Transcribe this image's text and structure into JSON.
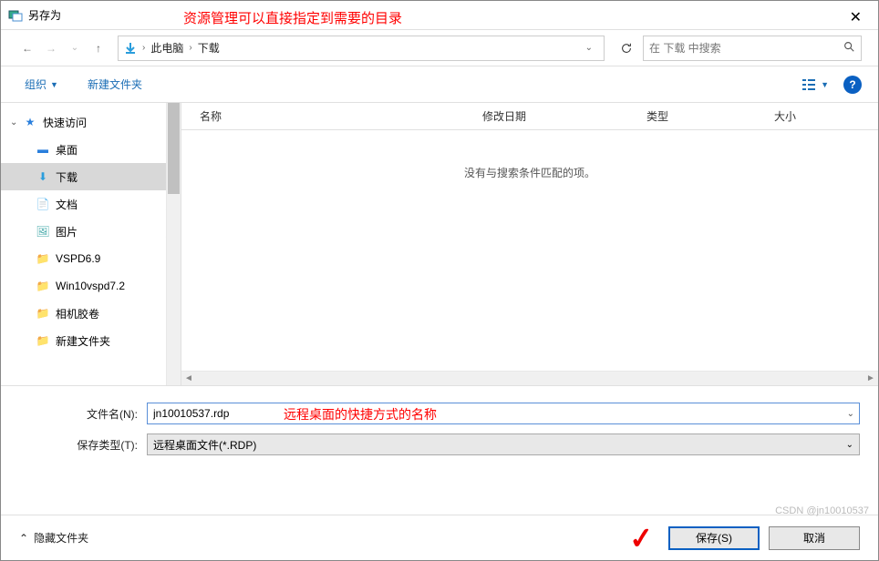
{
  "title": "另存为",
  "annotation_top": "资源管理可以直接指定到需要的目录",
  "breadcrumb": {
    "seg1": "此电脑",
    "seg2": "下载"
  },
  "search": {
    "placeholder": "在 下载 中搜索"
  },
  "toolbar": {
    "organize": "组织",
    "new_folder": "新建文件夹"
  },
  "tree": {
    "quick_access": "快速访问",
    "items": [
      {
        "label": "桌面",
        "pinned": true
      },
      {
        "label": "下载",
        "pinned": true
      },
      {
        "label": "文档",
        "pinned": true
      },
      {
        "label": "图片",
        "pinned": true
      },
      {
        "label": "VSPD6.9",
        "pinned": false
      },
      {
        "label": "Win10vspd7.2",
        "pinned": false
      },
      {
        "label": "相机胶卷",
        "pinned": false
      },
      {
        "label": "新建文件夹",
        "pinned": false
      }
    ]
  },
  "columns": {
    "name": "名称",
    "date": "修改日期",
    "type": "类型",
    "size": "大小"
  },
  "empty_message": "没有与搜索条件匹配的项。",
  "form": {
    "filename_label": "文件名(N):",
    "filename_value": "jn10010537.rdp",
    "filetype_label": "保存类型(T):",
    "filetype_value": "远程桌面文件(*.RDP)"
  },
  "annotation_filename": "远程桌面的快捷方式的名称",
  "footer": {
    "hide_folders": "隐藏文件夹",
    "save": "保存(S)",
    "cancel": "取消"
  },
  "watermark": "CSDN @jn10010537"
}
